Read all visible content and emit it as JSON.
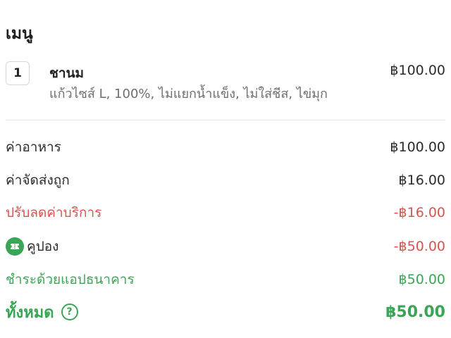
{
  "menu": {
    "title": "เมนู",
    "items": [
      {
        "qty": "1",
        "name": "ชานม",
        "options": "แก้วไซส์ L, 100%, ไม่แยกน้ำแข็ง, ไม่ใส่ชีส, ไข่มุก",
        "price": "฿100.00"
      }
    ]
  },
  "summary": {
    "food": {
      "label": "ค่าอาหาร",
      "value": "฿100.00"
    },
    "delivery": {
      "label": "ค่าจัดส่งถูก",
      "value": "฿16.00"
    },
    "service_discount": {
      "label": "ปรับลดค่าบริการ",
      "value": "-฿16.00"
    },
    "coupon": {
      "label": "คูปอง",
      "value": "-฿50.00",
      "icon": "coupon-icon"
    },
    "bank_app": {
      "label": "ชำระด้วยแอปธนาคาร",
      "value": "฿50.00"
    },
    "total": {
      "label": "ทั้งหมด",
      "value": "฿50.00",
      "help_icon_glyph": "?"
    }
  },
  "colors": {
    "discount": "#d9534f",
    "accent": "#3aa655"
  }
}
